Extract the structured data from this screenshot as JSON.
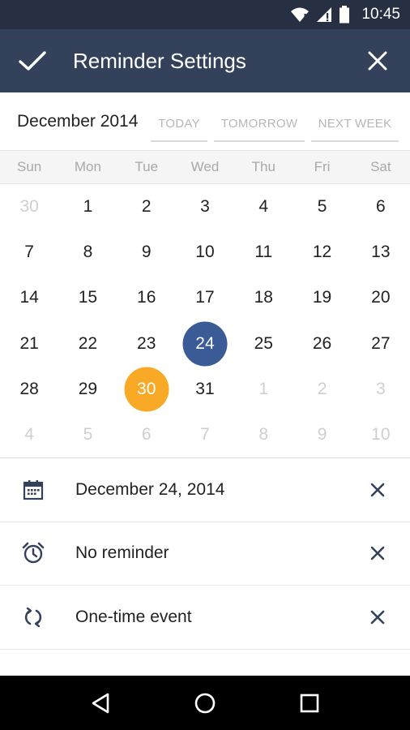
{
  "status_bar": {
    "time": "10:45"
  },
  "app_bar": {
    "title": "Reminder Settings"
  },
  "quick_select": {
    "month_label": "December 2014",
    "today": "TODAY",
    "tomorrow": "TOMORROW",
    "next_week": "NEXT WEEK"
  },
  "calendar": {
    "weekdays": [
      "Sun",
      "Mon",
      "Tue",
      "Wed",
      "Thu",
      "Fri",
      "Sat"
    ],
    "weeks": [
      [
        {
          "d": "30",
          "m": true
        },
        {
          "d": "1"
        },
        {
          "d": "2"
        },
        {
          "d": "3"
        },
        {
          "d": "4"
        },
        {
          "d": "5"
        },
        {
          "d": "6"
        }
      ],
      [
        {
          "d": "7"
        },
        {
          "d": "8"
        },
        {
          "d": "9"
        },
        {
          "d": "10"
        },
        {
          "d": "11"
        },
        {
          "d": "12"
        },
        {
          "d": "13"
        }
      ],
      [
        {
          "d": "14"
        },
        {
          "d": "15"
        },
        {
          "d": "16"
        },
        {
          "d": "17"
        },
        {
          "d": "18"
        },
        {
          "d": "19"
        },
        {
          "d": "20"
        }
      ],
      [
        {
          "d": "21"
        },
        {
          "d": "22"
        },
        {
          "d": "23"
        },
        {
          "d": "24",
          "sel": true
        },
        {
          "d": "25"
        },
        {
          "d": "26"
        },
        {
          "d": "27"
        }
      ],
      [
        {
          "d": "28"
        },
        {
          "d": "29"
        },
        {
          "d": "30",
          "today": true
        },
        {
          "d": "31"
        },
        {
          "d": "1",
          "m": true
        },
        {
          "d": "2",
          "m": true
        },
        {
          "d": "3",
          "m": true
        }
      ],
      [
        {
          "d": "4",
          "m": true
        },
        {
          "d": "5",
          "m": true
        },
        {
          "d": "6",
          "m": true
        },
        {
          "d": "7",
          "m": true
        },
        {
          "d": "8",
          "m": true
        },
        {
          "d": "9",
          "m": true
        },
        {
          "d": "10",
          "m": true
        }
      ]
    ],
    "selected_color": "#3a5b96",
    "today_color": "#f8a926"
  },
  "details": {
    "date": "December 24, 2014",
    "reminder": "No reminder",
    "repeat": "One-time event"
  }
}
